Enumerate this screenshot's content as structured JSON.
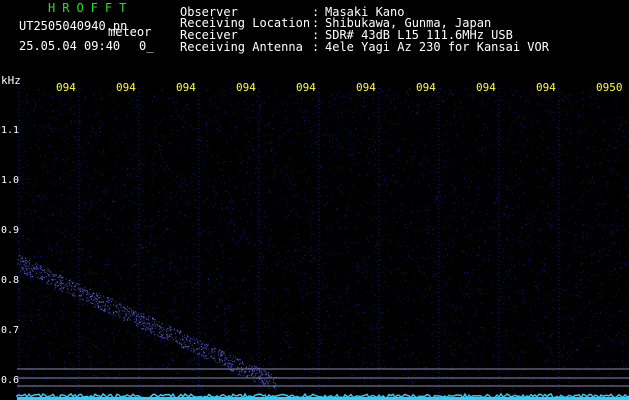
{
  "header": {
    "app_title": "HROFFT",
    "file_name": "UT2505040940.pn",
    "mode": "meteor",
    "date_time": "25.05.04 09:40",
    "level": "0_"
  },
  "info": [
    {
      "label": "Observer",
      "value": "Masaki Kano"
    },
    {
      "label": "Receiving Location",
      "value": "Shibukawa, Gunma, Japan"
    },
    {
      "label": "Receiver",
      "value": "SDR# 43dB L15 111.6MHz USB"
    },
    {
      "label": "Receiving Antenna",
      "value": "4ele Yagi Az 230 for Kansai VOR"
    }
  ],
  "info_separator": ":",
  "axis": {
    "unit": "kHz",
    "time_ticks": [
      "094",
      "094",
      "094",
      "094",
      "094",
      "094",
      "094",
      "094",
      "094",
      "0950"
    ],
    "freq_ticks": [
      "1.1",
      "1.0",
      "0.9",
      "0.8",
      "0.7",
      "0.6"
    ]
  },
  "colors": {
    "background": "#000000",
    "title": "#22e022",
    "time_ticks": "#ffff33",
    "text": "#ffffff",
    "noise": "#1e1ea6",
    "trace": "#6a6aff",
    "baseline": "#2ad0ff",
    "reference_lines": "#8a8ab0"
  }
}
